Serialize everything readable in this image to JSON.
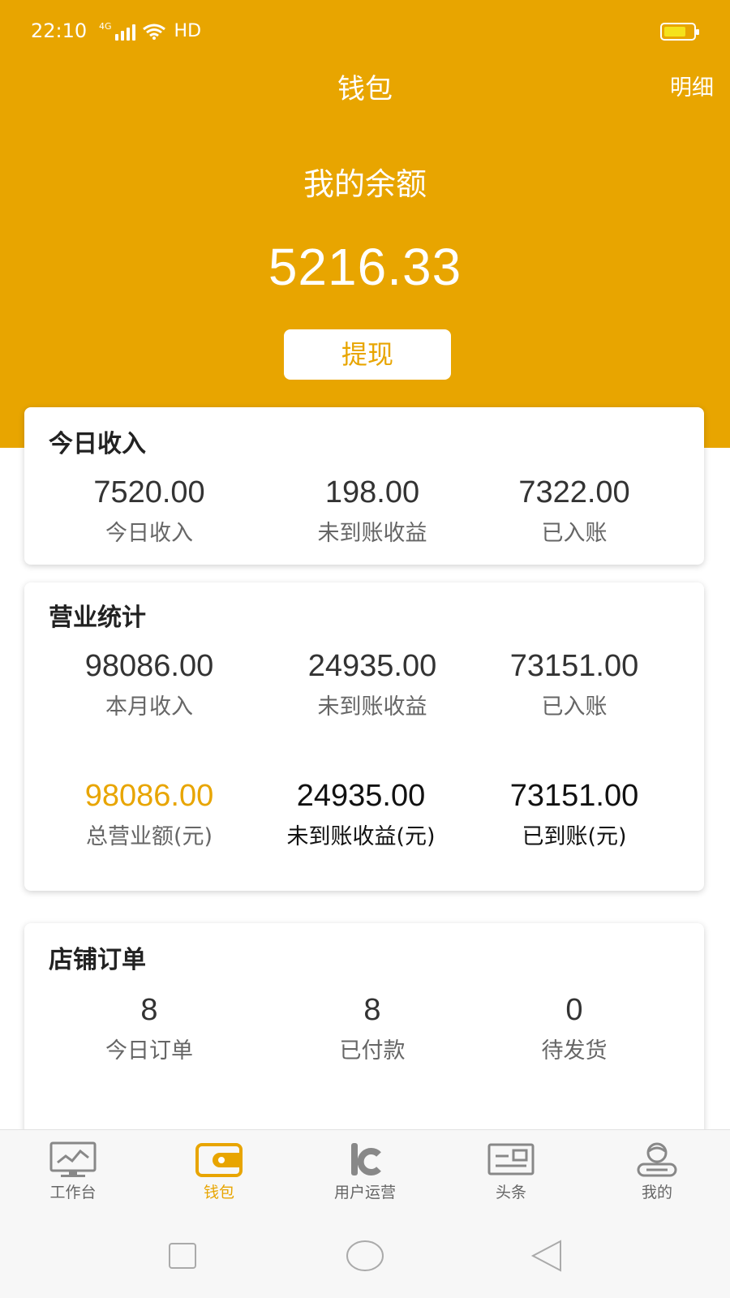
{
  "status": {
    "time": "22:10",
    "network": "4G",
    "hd": "HD"
  },
  "header": {
    "title": "钱包",
    "detail_link": "明细"
  },
  "balance": {
    "label": "我的余额",
    "amount": "5216.33",
    "withdraw_label": "提现"
  },
  "today_income": {
    "title": "今日收入",
    "stats": [
      {
        "value": "7520.00",
        "label": "今日收入"
      },
      {
        "value": "198.00",
        "label": "未到账收益"
      },
      {
        "value": "7322.00",
        "label": "已入账"
      }
    ]
  },
  "business_stats": {
    "title": "营业统计",
    "row1": [
      {
        "value": "98086.00",
        "label": "本月收入"
      },
      {
        "value": "24935.00",
        "label": "未到账收益"
      },
      {
        "value": "73151.00",
        "label": "已入账"
      }
    ],
    "row2": [
      {
        "value": "98086.00",
        "label": "总营业额(元)"
      },
      {
        "value": "24935.00",
        "label": "未到账收益(元)"
      },
      {
        "value": "73151.00",
        "label": "已到账(元)"
      }
    ]
  },
  "shop_orders": {
    "title": "店铺订单",
    "stats": [
      {
        "value": "8",
        "label": "今日订单"
      },
      {
        "value": "8",
        "label": "已付款"
      },
      {
        "value": "0",
        "label": "待发货"
      }
    ]
  },
  "tabs": [
    {
      "label": "工作台",
      "icon": "monitor-chart-icon"
    },
    {
      "label": "钱包",
      "icon": "wallet-icon"
    },
    {
      "label": "用户运营",
      "icon": "user-operation-icon"
    },
    {
      "label": "头条",
      "icon": "news-icon"
    },
    {
      "label": "我的",
      "icon": "profile-icon"
    }
  ],
  "colors": {
    "accent": "#E8A500",
    "background": "#FFFFFF",
    "tab_inactive": "#666666"
  }
}
